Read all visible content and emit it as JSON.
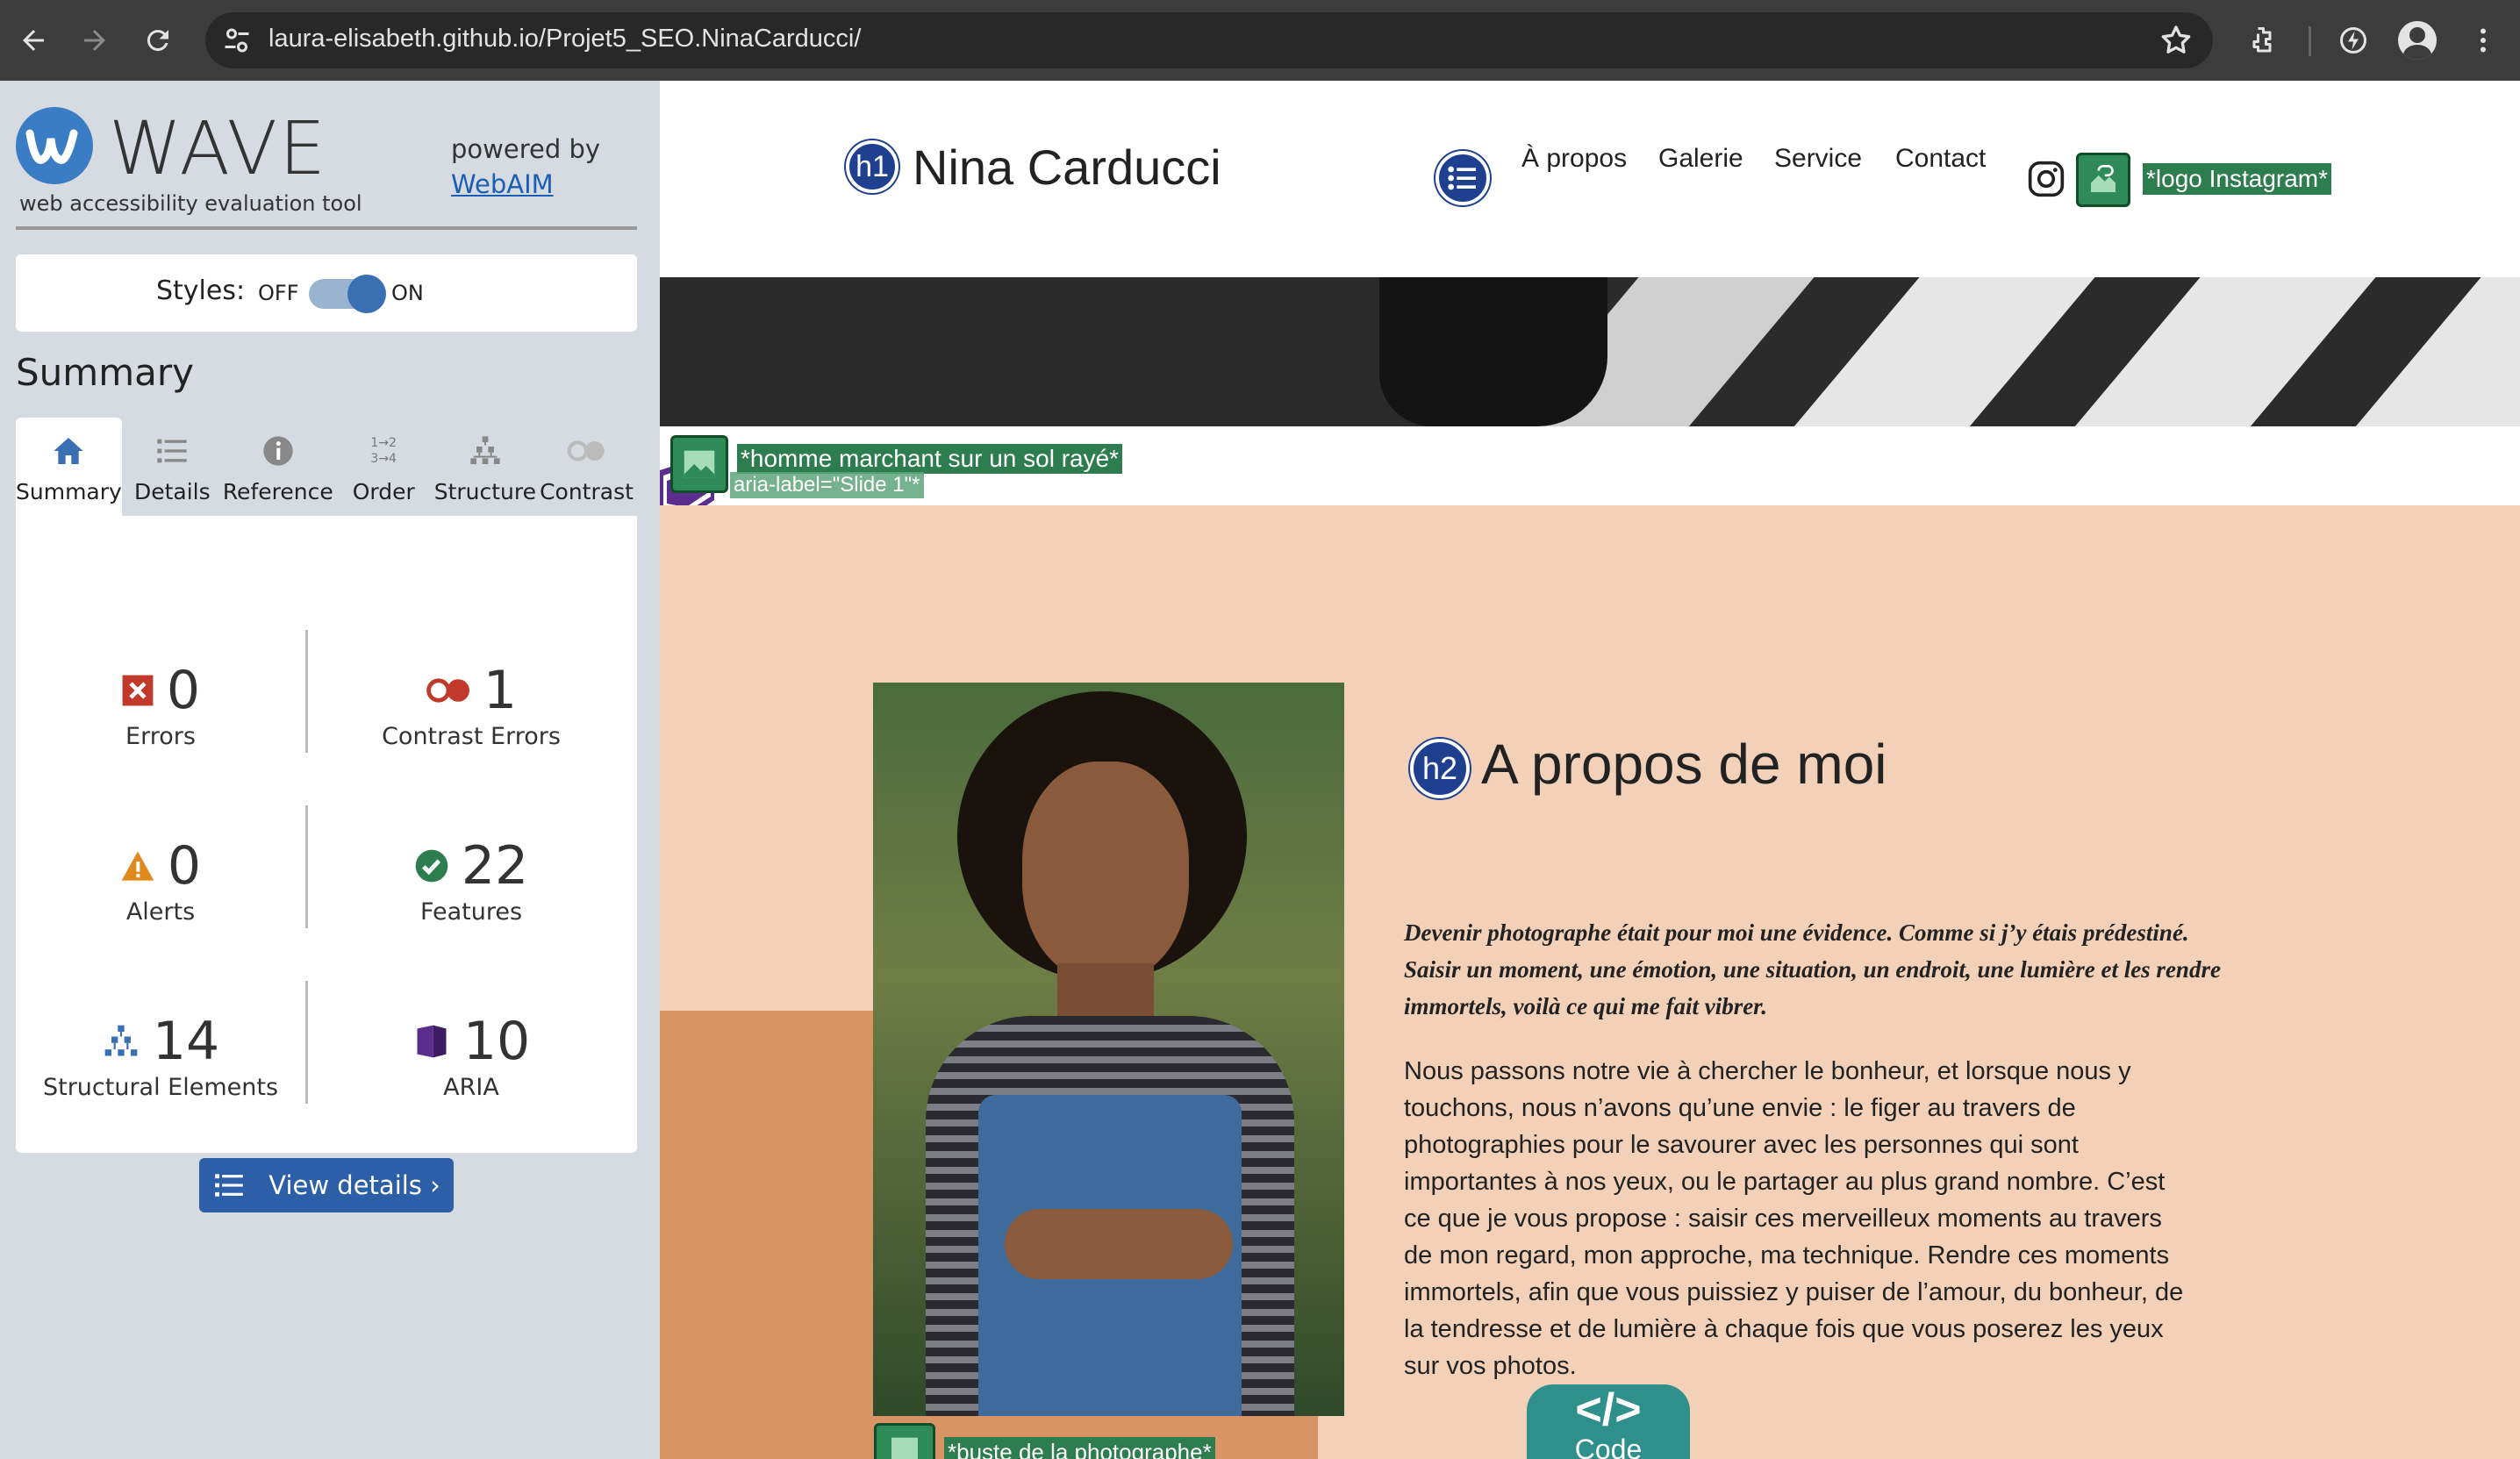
{
  "browser": {
    "url": "laura-elisabeth.github.io/Projet5_SEO.NinaCarducci/"
  },
  "wave": {
    "title": "WAVE",
    "subtitle": "web accessibility evaluation tool",
    "powered_by": "powered by",
    "webaim": "WebAIM",
    "styles_label": "Styles:",
    "styles_off": "OFF",
    "styles_on": "ON",
    "summary_heading": "Summary",
    "tabs": [
      {
        "label": "Summary",
        "icon": "home-icon"
      },
      {
        "label": "Details",
        "icon": "list-icon"
      },
      {
        "label": "Reference",
        "icon": "info-icon"
      },
      {
        "label": "Order",
        "icon": "order-icon"
      },
      {
        "label": "Structure",
        "icon": "structure-icon"
      },
      {
        "label": "Contrast",
        "icon": "contrast-icon"
      }
    ],
    "order_icon_text": [
      "1→2",
      "3→4"
    ],
    "stats": {
      "errors": {
        "value": "0",
        "label": "Errors"
      },
      "contrast": {
        "value": "1",
        "label": "Contrast Errors"
      },
      "alerts": {
        "value": "0",
        "label": "Alerts"
      },
      "features": {
        "value": "22",
        "label": "Features"
      },
      "structural": {
        "value": "14",
        "label": "Structural Elements"
      },
      "aria": {
        "value": "10",
        "label": "ARIA"
      }
    },
    "view_details": "View details ›",
    "colors": {
      "accent": "#2d5ea8",
      "error": "#c0392b",
      "alert": "#e08a1e",
      "feature": "#2e7d4f",
      "aria": "#5b2d8c"
    }
  },
  "site": {
    "h1_badge": "h1",
    "title": "Nina Carducci",
    "nav": [
      "À propos",
      "Galerie",
      "Service",
      "Contact"
    ],
    "instagram_alt": "*logo Instagram*",
    "hero_alt": "*homme marchant sur un sol rayé*",
    "aria_label": "aria-label=\"Slide 1\"*",
    "h2_badge": "h2",
    "about_title": "A propos de moi",
    "about_lead": "Devenir photographe était pour moi une évidence. Comme si j’y étais prédestiné. Saisir un moment, une émotion, une situation, un endroit, une lumière et les rendre immortels, voilà ce qui me fait vibrer.",
    "about_body": "Nous passons notre vie à chercher le bonheur, et lorsque nous y touchons, nous n’avons qu’une envie : le figer au travers de photographies pour le savourer avec les personnes qui sont importantes à nos yeux, ou le partager au plus grand nombre. C’est ce que je vous propose : saisir ces merveilleux moments au travers de mon regard, mon approche, ma technique. Rendre ces moments immortels, afin que vous puissiez y puiser de l’amour, du bonheur, de la tendresse et de lumière à chaque fois que vous poserez les yeux sur vos photos.",
    "photo_alt": "*buste de la photographe*",
    "code_badge_symbol": "</>",
    "code_badge_label": "Code"
  }
}
